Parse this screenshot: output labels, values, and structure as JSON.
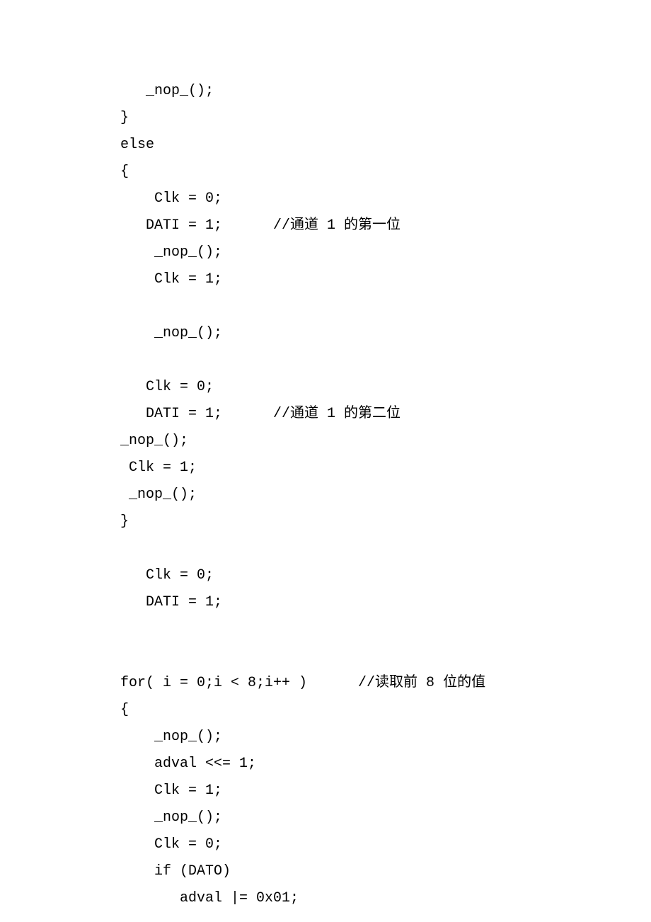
{
  "lines": [
    "   _nop_();",
    "}",
    "else",
    "{",
    "    Clk = 0;",
    "   DATI = 1;      //通道 1 的第一位",
    "    _nop_();",
    "    Clk = 1;",
    "",
    "    _nop_();",
    "",
    "   Clk = 0;",
    "   DATI = 1;      //通道 1 的第二位",
    "_nop_();",
    " Clk = 1;",
    " _nop_();",
    "}",
    "",
    "   Clk = 0;",
    "   DATI = 1;",
    "",
    "",
    "for( i = 0;i < 8;i++ )      //读取前 8 位的值",
    "{",
    "    _nop_();",
    "    adval <<= 1;",
    "    Clk = 1;",
    "    _nop_();",
    "    Clk = 0;",
    "    if (DATO)",
    "       adval |= 0x01;"
  ]
}
